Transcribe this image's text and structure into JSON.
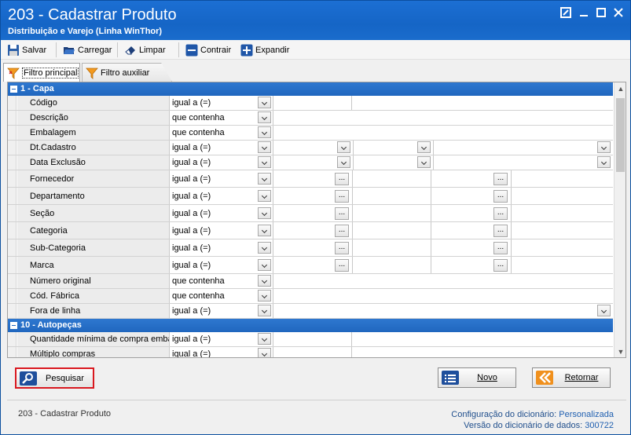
{
  "window": {
    "title": "203 - Cadastrar  Produto",
    "subtitle": "Distribuição e Varejo (Linha WinThor)",
    "controls": {
      "restore_icon": "restore-icon",
      "minimize_icon": "minimize-icon",
      "maximize_icon": "maximize-icon",
      "close_icon": "close-icon"
    }
  },
  "toolbar": {
    "salvar": "Salvar",
    "carregar": "Carregar",
    "limpar": "Limpar",
    "contrair": "Contrair",
    "expandir": "Expandir"
  },
  "tabs": [
    {
      "label": "Filtro principal",
      "active": true
    },
    {
      "label": "Filtro auxiliar",
      "active": false
    }
  ],
  "sections": [
    {
      "title": "1 - Capa",
      "rows": [
        {
          "label": "Código",
          "operator": "igual a (=)"
        },
        {
          "label": "Descrição",
          "operator": "que contenha"
        },
        {
          "label": "Embalagem",
          "operator": "que contenha"
        },
        {
          "label": "Dt.Cadastro",
          "operator": "igual a (=)"
        },
        {
          "label": "Data Exclusão",
          "operator": "igual a (=)"
        },
        {
          "label": "Fornecedor",
          "operator": "igual a (=)"
        },
        {
          "label": "Departamento",
          "operator": "igual a (=)"
        },
        {
          "label": "Seção",
          "operator": "igual a (=)"
        },
        {
          "label": "Categoria",
          "operator": "igual a (=)"
        },
        {
          "label": "Sub-Categoria",
          "operator": "igual a (=)"
        },
        {
          "label": "Marca",
          "operator": "igual a (=)"
        },
        {
          "label": "Número original",
          "operator": "que contenha"
        },
        {
          "label": "Cód. Fábrica",
          "operator": "que contenha"
        },
        {
          "label": "Fora de linha",
          "operator": "igual a (=)"
        }
      ]
    },
    {
      "title": "10 - Autopeças",
      "rows": [
        {
          "label": "Quantidade mínima de compra embal",
          "operator": "igual a (=)"
        },
        {
          "label": "Múltiplo compras",
          "operator": "igual a (=)"
        }
      ]
    }
  ],
  "ellipsis": "...",
  "buttons": {
    "pesquisar": "Pesquisar",
    "novo": "Novo",
    "retornar": "Retornar"
  },
  "footer": {
    "left": "203 - Cadastrar  Produto",
    "config_label": "Configuração do dicionário:",
    "config_value": "Personalizada",
    "version_label": "Versão do dicionário de dados:",
    "version_value": "300722"
  }
}
